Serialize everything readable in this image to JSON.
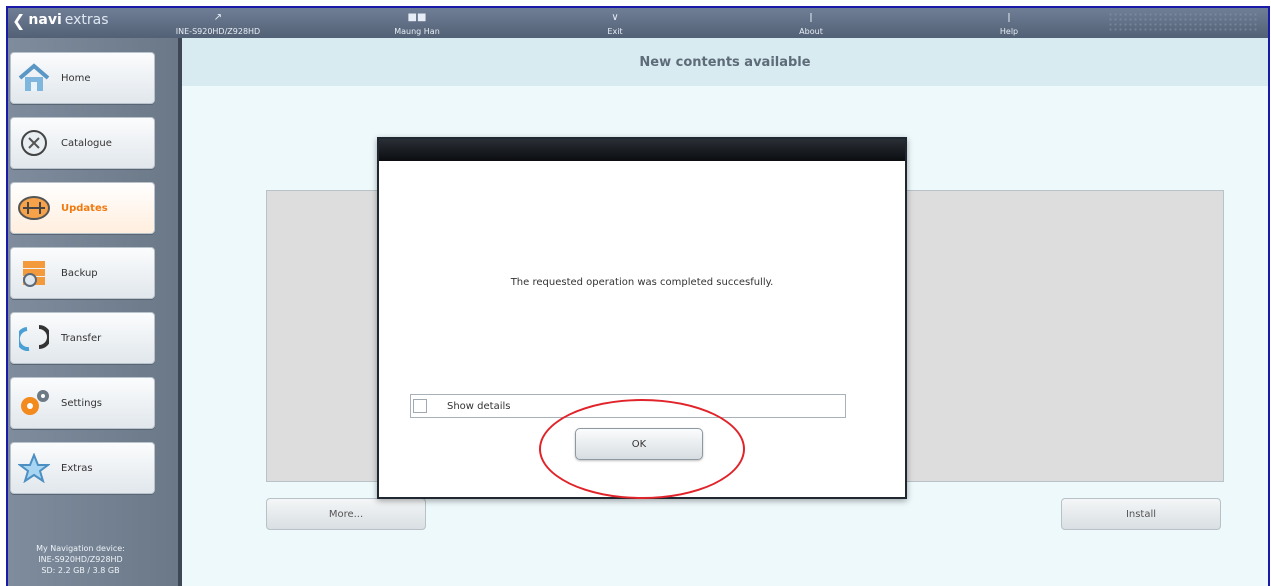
{
  "app": {
    "logo_navi": "navi",
    "logo_extras": "extras"
  },
  "topbar": {
    "items": [
      {
        "label": "INE-S920HD/Z928HD",
        "icon": "signal-icon"
      },
      {
        "label": "Maung Han",
        "icon": "user-icon"
      },
      {
        "label": "Exit",
        "icon": "exit-icon"
      },
      {
        "label": "About",
        "icon": "info-icon"
      },
      {
        "label": "Help",
        "icon": "help-icon"
      }
    ]
  },
  "sidebar": {
    "items": [
      {
        "label": "Home",
        "icon": "home-icon",
        "active": false
      },
      {
        "label": "Catalogue",
        "icon": "catalogue-icon",
        "active": false
      },
      {
        "label": "Updates",
        "icon": "updates-icon",
        "active": true
      },
      {
        "label": "Backup",
        "icon": "backup-icon",
        "active": false
      },
      {
        "label": "Transfer",
        "icon": "transfer-icon",
        "active": false
      },
      {
        "label": "Settings",
        "icon": "settings-icon",
        "active": false
      },
      {
        "label": "Extras",
        "icon": "star-icon",
        "active": false
      }
    ],
    "device_line1": "My Navigation device:",
    "device_line2": "INE-S920HD/Z928HD",
    "device_line3": "SD: 2.2 GB / 3.8 GB"
  },
  "content": {
    "header_title": "New contents available",
    "more_button": "More...",
    "install_button": "Install"
  },
  "dialog": {
    "message": "The requested operation was completed succesfully.",
    "show_details_label": "Show details",
    "ok_label": "OK"
  },
  "colors": {
    "active_accent": "#f07a10",
    "highlight": "#e0242a"
  }
}
